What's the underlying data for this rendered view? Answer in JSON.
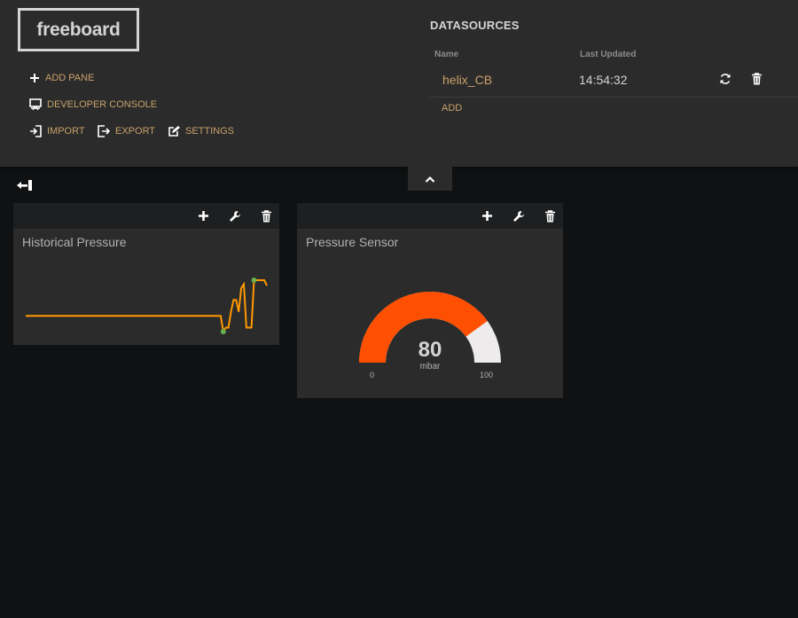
{
  "app": {
    "logo": "freeboard"
  },
  "menu": {
    "add_pane": "ADD PANE",
    "developer_console": "DEVELOPER CONSOLE",
    "import": "IMPORT",
    "export": "EXPORT",
    "settings": "SETTINGS"
  },
  "datasources": {
    "title": "DATASOURCES",
    "columns": {
      "name": "Name",
      "last_updated": "Last Updated"
    },
    "rows": [
      {
        "name": "helix_CB",
        "last_updated": "14:54:32"
      }
    ],
    "add_label": "ADD"
  },
  "panes": [
    {
      "title": "Historical Pressure",
      "widget": "sparkline",
      "sparkline_values": [
        50,
        50,
        50,
        50,
        50,
        50,
        50,
        50,
        50,
        50,
        50,
        50,
        50,
        50,
        50,
        50,
        50,
        50,
        50,
        50,
        50,
        50,
        50,
        50,
        50,
        50,
        50,
        50,
        50,
        50,
        50,
        50,
        50,
        50,
        50,
        50,
        50,
        50,
        50,
        50,
        50,
        50,
        50,
        50,
        50,
        50,
        50,
        50,
        50,
        50,
        50,
        50,
        50,
        50,
        50,
        50,
        50,
        50,
        50,
        50,
        50,
        50,
        50,
        50,
        50,
        50,
        50,
        50,
        50,
        50,
        50,
        50,
        50,
        50,
        50,
        50,
        50,
        30,
        35,
        35,
        55,
        70,
        70,
        55,
        85,
        90,
        35,
        35,
        35,
        95,
        95,
        95,
        95,
        95,
        88
      ]
    },
    {
      "title": "Pressure Sensor",
      "widget": "gauge",
      "gauge": {
        "value": 80,
        "units": "mbar",
        "min": 0,
        "max": 100,
        "min_label": "0",
        "max_label": "100"
      }
    }
  ],
  "colors": {
    "accent": "#ff9900",
    "link": "#c8a16a",
    "sparkline": "#ff9900",
    "sparkline_marker": "#6ab04c",
    "gauge_fill": "#ff4f00",
    "gauge_track": "#edebeb",
    "panel_bg": "#2b2b2b",
    "page_bg": "#101112"
  }
}
